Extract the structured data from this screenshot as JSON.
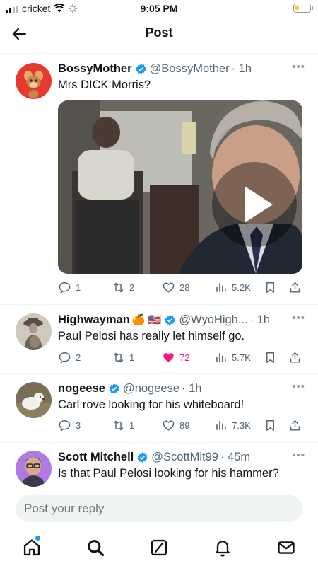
{
  "status_bar": {
    "carrier": "cricket",
    "time": "9:05 PM"
  },
  "header": {
    "title": "Post"
  },
  "main_post": {
    "name": "BossyMother",
    "handle": "@BossyMother",
    "time": "· 1h",
    "text": "Mrs DICK Morris?",
    "replies": "1",
    "reposts": "2",
    "likes": "28",
    "views": "5.2K"
  },
  "replies": [
    {
      "name": "Highwayman",
      "emoji": "🍊 🇺🇸",
      "handle": "@WyoHigh...",
      "time": "· 1h",
      "text": "Paul Pelosi has really let himself go.",
      "replies": "2",
      "reposts": "1",
      "likes": "72",
      "views": "5.7K",
      "liked": true
    },
    {
      "name": "nogeese",
      "handle": "@nogeese",
      "time": "· 1h",
      "text": "Carl rove looking for his whiteboard!",
      "replies": "3",
      "reposts": "1",
      "likes": "89",
      "views": "7.3K"
    },
    {
      "name": "Scott Mitchell",
      "handle": "@ScottMit99",
      "time": "· 45m",
      "text": "Is that Paul Pelosi looking for his hammer?"
    }
  ],
  "reply_bar": {
    "placeholder": "Post your reply"
  },
  "colors": {
    "accent": "#1d9bf0",
    "like": "#f91880",
    "muted": "#536471"
  },
  "icons": [
    "back-arrow-icon",
    "verified-badge-icon",
    "more-icon",
    "reply-icon",
    "repost-icon",
    "like-icon",
    "views-icon",
    "bookmark-icon",
    "share-icon",
    "play-icon",
    "home-icon",
    "search-icon",
    "grok-icon",
    "notifications-icon",
    "messages-icon"
  ]
}
